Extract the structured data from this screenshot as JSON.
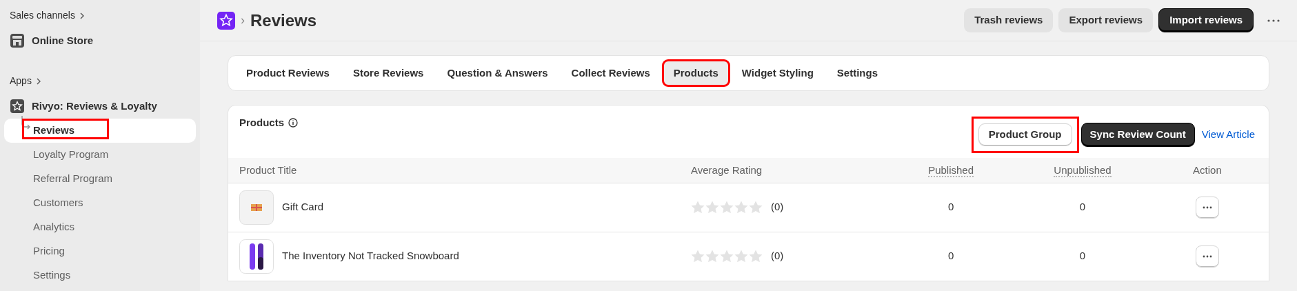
{
  "sidebar": {
    "sections": [
      {
        "heading": "Sales channels",
        "items": [
          {
            "label": "Online Store",
            "selected": false
          }
        ]
      },
      {
        "heading": "Apps",
        "items": [
          {
            "label": "Rivyo: Reviews & Loyalty",
            "selected": false,
            "children": [
              {
                "label": "Reviews",
                "selected": true,
                "highlighted": true
              },
              {
                "label": "Loyalty Program",
                "selected": false,
                "highlighted": false
              },
              {
                "label": "Referral Program",
                "selected": false,
                "highlighted": false
              },
              {
                "label": "Customers",
                "selected": false,
                "highlighted": false
              },
              {
                "label": "Analytics",
                "selected": false,
                "highlighted": false
              },
              {
                "label": "Pricing",
                "selected": false,
                "highlighted": false
              },
              {
                "label": "Settings",
                "selected": false,
                "highlighted": false
              }
            ]
          }
        ]
      }
    ]
  },
  "header": {
    "separator": "›",
    "title": "Reviews",
    "buttons": [
      {
        "label": "Trash reviews",
        "kind": "secondary"
      },
      {
        "label": "Export reviews",
        "kind": "secondary"
      },
      {
        "label": "Import reviews",
        "kind": "primary"
      }
    ]
  },
  "tabs": [
    {
      "label": "Product Reviews",
      "selected": false,
      "highlighted": false
    },
    {
      "label": "Store Reviews",
      "selected": false,
      "highlighted": false
    },
    {
      "label": "Question & Answers",
      "selected": false,
      "highlighted": false
    },
    {
      "label": "Collect Reviews",
      "selected": false,
      "highlighted": false
    },
    {
      "label": "Products",
      "selected": true,
      "highlighted": true
    },
    {
      "label": "Widget Styling",
      "selected": false,
      "highlighted": false
    },
    {
      "label": "Settings",
      "selected": false,
      "highlighted": false
    }
  ],
  "products": {
    "title": "Products",
    "actions": [
      {
        "label": "Product Group",
        "kind": "outline",
        "highlighted": true
      },
      {
        "label": "Sync Review Count",
        "kind": "primary",
        "highlighted": false
      },
      {
        "label": "View Article",
        "kind": "link",
        "highlighted": false
      }
    ],
    "table": {
      "columns": [
        "Product Title",
        "Average Rating",
        "Published",
        "Unpublished",
        "Action"
      ],
      "rows": [
        {
          "title": "Gift Card",
          "stars": 0,
          "count": "(0)",
          "published": "0",
          "unpublished": "0"
        },
        {
          "title": "The Inventory Not Tracked Snowboard",
          "stars": 0,
          "count": "(0)",
          "published": "0",
          "unpublished": "0"
        }
      ]
    }
  }
}
